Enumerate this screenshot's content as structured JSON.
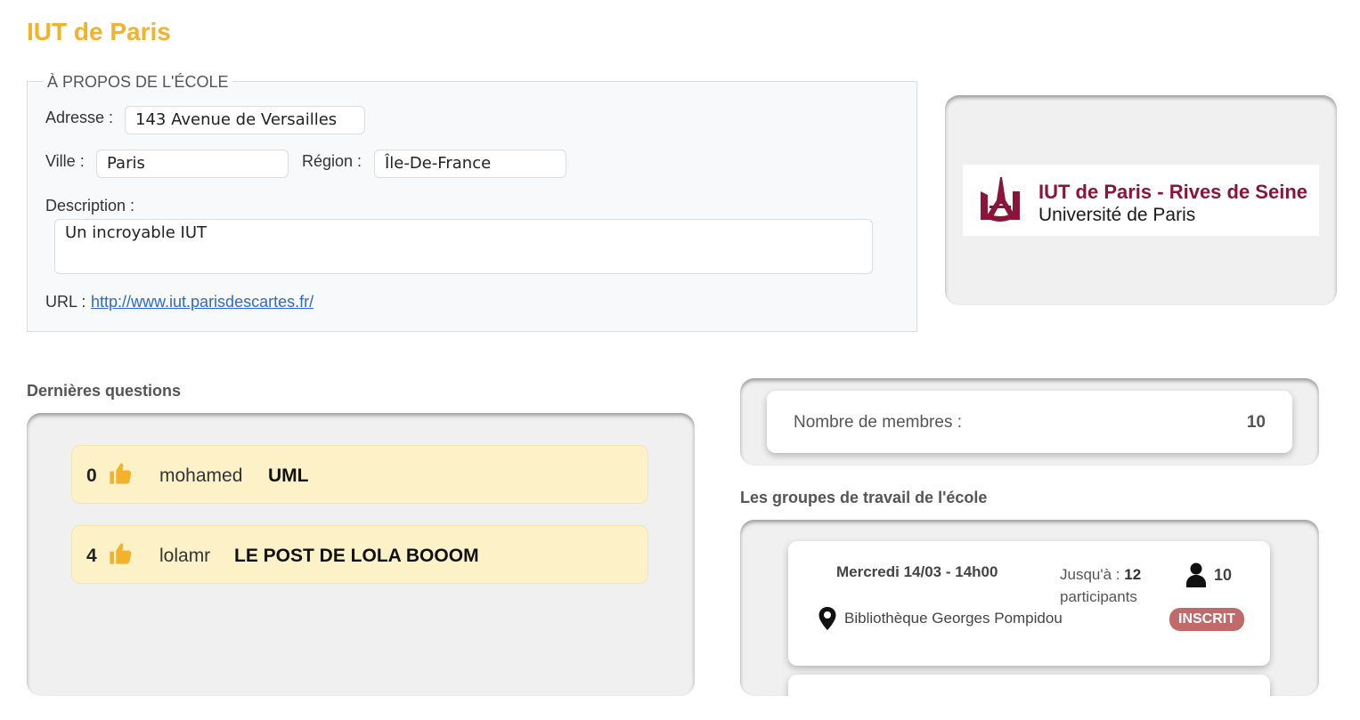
{
  "page": {
    "title": "IUT de Paris"
  },
  "about": {
    "legend": "À PROPOS DE L'ÉCOLE",
    "address_label": "Adresse :",
    "address_value": "143 Avenue de Versailles",
    "city_label": "Ville :",
    "city_value": "Paris",
    "region_label": "Région :",
    "region_value": "Île-De-France",
    "description_label": "Description :",
    "description_value": "Un incroyable IUT",
    "url_label": "URL :",
    "url_value": "http://www.iut.parisdescartes.fr/"
  },
  "logo": {
    "line1": "IUT de Paris - Rives de Seine",
    "line2": "Université de Paris"
  },
  "questions": {
    "title": "Dernières questions",
    "items": [
      {
        "votes": "0",
        "user": "mohamed",
        "title": "UML"
      },
      {
        "votes": "4",
        "user": "lolamr",
        "title": "LE POST DE LOLA BOOOM"
      }
    ]
  },
  "members": {
    "label": "Nombre de membres :",
    "count": "10"
  },
  "groups": {
    "title": "Les groupes de travail de l'école",
    "items": [
      {
        "date": "Mercredi 14/03 - 14h00",
        "until_prefix": "Jusqu'à :",
        "max": "12",
        "until_suffix": "participants",
        "participants": "10",
        "place": "Bibliothèque Georges Pompidou",
        "status": "INSCRIT"
      }
    ]
  },
  "colors": {
    "title": "#f4b22a",
    "question_bg": "#fdf2c7",
    "thumb": "#f4b22a",
    "badge": "#c06a6a",
    "logo_red": "#8b1538",
    "link": "#2a6ad6"
  },
  "icons": [
    "thumbs-up-icon",
    "user-icon",
    "map-pin-icon",
    "eiffel-logo-icon"
  ]
}
